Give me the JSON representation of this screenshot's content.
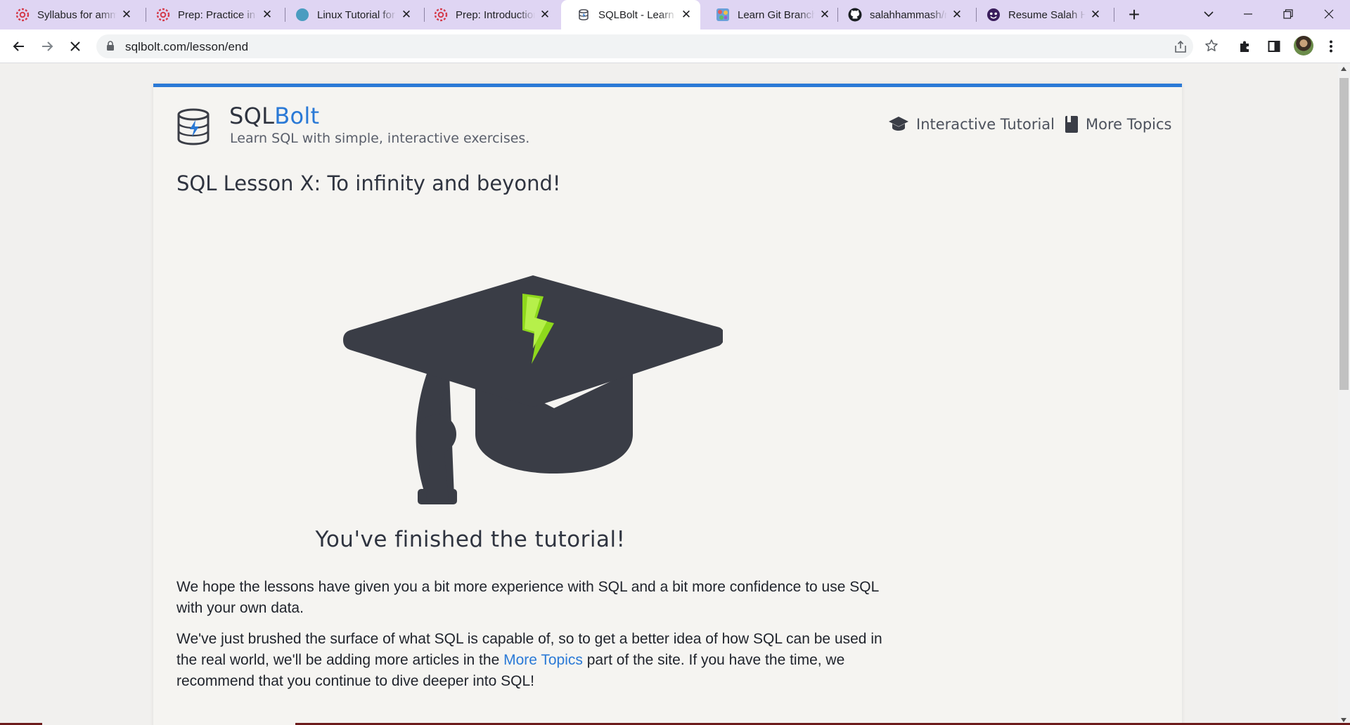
{
  "tabs": [
    {
      "title": "Syllabus for ammar",
      "favicon": "gear-icon",
      "active": false
    },
    {
      "title": "Prep: Practice in the",
      "favicon": "gear-icon",
      "active": false
    },
    {
      "title": "Linux Tutorial for",
      "favicon": "circle-icon",
      "active": false
    },
    {
      "title": "Prep: Introduction",
      "favicon": "gear-icon",
      "active": false
    },
    {
      "title": "SQLBolt - Learn SQL",
      "favicon": "database-icon",
      "active": true
    },
    {
      "title": "Learn Git Branching",
      "favicon": "git-icon",
      "active": false
    },
    {
      "title": "salahhammash/resume",
      "favicon": "github-icon",
      "active": false
    },
    {
      "title": "Resume Salah Hammash",
      "favicon": "face-icon",
      "active": false
    }
  ],
  "browser": {
    "url": "sqlbolt.com/lesson/end"
  },
  "site": {
    "brand_main": "SQL",
    "brand_accent": "Bolt",
    "tagline": "Learn SQL with simple, interactive exercises.",
    "nav_tutorial": "Interactive Tutorial",
    "nav_topics": "More Topics"
  },
  "lesson": {
    "title": "SQL Lesson X: To infinity and beyond!",
    "finished_caption": "You've finished the tutorial!",
    "para1": "We hope the lessons have given you a bit more experience with SQL and a bit more confidence to use SQL with your own data.",
    "para2_before": "We've just brushed the surface of what SQL is capable of, so to get a better idea of how SQL can be used in the real world, we'll be adding more articles in the ",
    "para2_link": "More Topics",
    "para2_after": " part of the site. If you have the time, we recommend that you continue to dive deeper into SQL!"
  },
  "colors": {
    "accent": "#2a79d6",
    "tabstrip": "#dfd5f3",
    "cap": "#3a3d46",
    "bolt": "#8ed81c"
  }
}
